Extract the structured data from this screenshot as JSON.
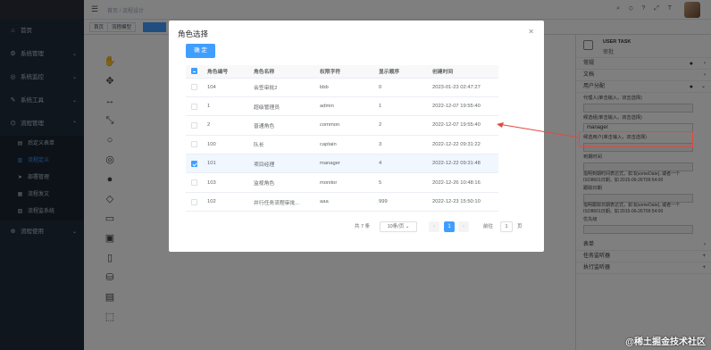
{
  "sidebar": {
    "logo": "",
    "items": [
      {
        "icon": "⌂",
        "label": "首页"
      },
      {
        "icon": "⚙",
        "label": "系统管理"
      },
      {
        "icon": "◎",
        "label": "系统监控"
      },
      {
        "icon": "✎",
        "label": "系统工具"
      },
      {
        "icon": "⌬",
        "label": "流程管理"
      }
    ],
    "subitems": [
      {
        "icon": "▤",
        "label": "后定义表单"
      },
      {
        "icon": "▥",
        "label": "流程定义"
      },
      {
        "icon": "➤",
        "label": "部署管理"
      },
      {
        "icon": "▦",
        "label": "流程发文"
      },
      {
        "icon": "▧",
        "label": "流程监系统"
      }
    ],
    "extra": {
      "icon": "⊕",
      "label": "流程使用"
    }
  },
  "topbar": {
    "breadcrumb": "首页 / 流程设计"
  },
  "tags": [
    "首页",
    "流程模型"
  ],
  "props": {
    "type": "USER TASK",
    "name": "审批",
    "groups": [
      "常规",
      "文档",
      "用户分配"
    ],
    "labels": {
      "assignee": "代理人(单击输入，双击选择)",
      "candidate_users": "候选组(单击输入，双击选择)",
      "candidate_groups": "候选用户(单击输入，双击选择)",
      "due_date": "到期时间",
      "due_desc": "指明到期时间表达式，如 ${someDate}, 或者一个ISO8601日期，如 2015-06-26T09:54:00",
      "follow_up": "跟踪日期",
      "follow_desc": "指明跟踪日期表达式，如 ${someDate}, 或者一个ISO8601日期，如 2015-06-26T09:54:00",
      "priority": "优先级"
    },
    "group_value": "manager",
    "bottom_groups": [
      "表单",
      "任务监听器",
      "执行监听器",
      "扩展属性"
    ]
  },
  "dialog": {
    "title": "角色选择",
    "ok_label": "确 定",
    "columns": [
      "角色编号",
      "角色名称",
      "权限字符",
      "显示顺序",
      "创建时间"
    ],
    "rows": [
      {
        "id": "104",
        "name": "会签审批2",
        "key": "bbb",
        "order": "0",
        "created": "2023-01-23 02:47:27",
        "checked": false
      },
      {
        "id": "1",
        "name": "超级管理员",
        "key": "admin",
        "order": "1",
        "created": "2022-12-07 19:55:40",
        "checked": false
      },
      {
        "id": "2",
        "name": "普通角色",
        "key": "common",
        "order": "2",
        "created": "2022-12-07 19:55:40",
        "checked": false
      },
      {
        "id": "100",
        "name": "队长",
        "key": "captain",
        "order": "3",
        "created": "2022-12-22 09:31:22",
        "checked": false
      },
      {
        "id": "101",
        "name": "项目经理",
        "key": "manager",
        "order": "4",
        "created": "2022-12-22 09:31:48",
        "checked": true
      },
      {
        "id": "103",
        "name": "监视角色",
        "key": "monitor",
        "order": "5",
        "created": "2022-12-26 10:48:16",
        "checked": false
      },
      {
        "id": "102",
        "name": "并行任务流程审批...",
        "key": "aaa",
        "order": "999",
        "created": "2022-12-23 15:50:10",
        "checked": false
      }
    ],
    "pagination": {
      "total": "共 7 条",
      "page_size": "10条/页",
      "current": "1",
      "goto_prefix": "前往",
      "goto_value": "1",
      "goto_suffix": "页"
    }
  },
  "watermark": "@稀土掘金技术社区",
  "colors": {
    "accent": "#409eff",
    "sidebar": "#1f2d3d",
    "highlight": "#e04a3e"
  }
}
